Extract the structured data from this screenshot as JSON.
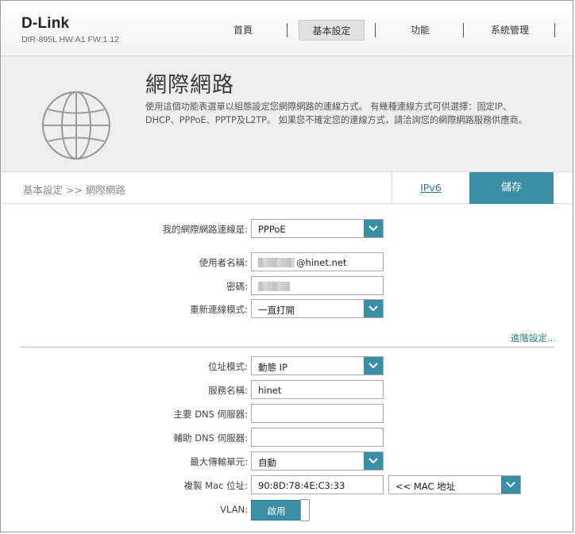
{
  "header": {
    "brand": "D-Link",
    "model": "DIR-895L HW:A1 FW:1.12",
    "tabs": [
      {
        "label": "首頁"
      },
      {
        "label": "基本設定"
      },
      {
        "label": "功能"
      },
      {
        "label": "系統管理"
      }
    ],
    "active_tab": "基本設定"
  },
  "hero": {
    "title": "網際網路",
    "description": "使用這個功能表選單以組態設定您網際網路的連線方式。 有幾種連線方式可供選擇：固定IP、DHCP、PPPoE、PPTP及L2TP。 如果您不確定您的連線方式，請洽詢您的網際網路服務供應商。",
    "icon": "globe-icon"
  },
  "breadcrumb": {
    "text": "基本設定 >> 網際網路",
    "ipv6_link": "IPv6",
    "save_label": "儲存"
  },
  "connection": {
    "type_label": "我的網際網路連線是:",
    "type_value": "PPPoE",
    "username_label": "使用者名稱:",
    "username_suffix": "@hinet.net",
    "password_label": "密碼:",
    "reconnect_label": "重新連線模式:",
    "reconnect_value": "一直打開"
  },
  "advanced_link": "進階設定...",
  "advanced": {
    "address_mode_label": "位址模式:",
    "address_mode_value": "動態 IP",
    "service_name_label": "服務名稱:",
    "service_name_value": "hinet",
    "primary_dns_label": "主要 DNS 伺服器:",
    "primary_dns_value": "",
    "secondary_dns_label": "輔助 DNS 伺服器:",
    "secondary_dns_value": "",
    "mtu_label": "最大傳輸單元:",
    "mtu_value": "自動",
    "mac_label": "複製 Mac 位址:",
    "mac_value": "90:8D:78:4E:C3:33",
    "mac_select": "<< MAC 地址",
    "vlan_label": "VLAN:",
    "vlan_value": "啟用"
  },
  "colors": {
    "accent": "#3a8fa6",
    "link": "#2f7d92",
    "hero_bg": "#eeeeee"
  }
}
